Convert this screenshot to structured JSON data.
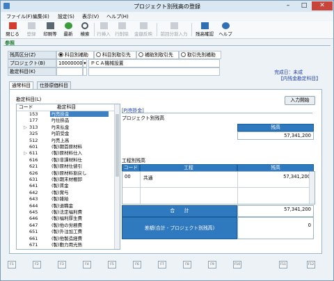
{
  "window": {
    "title": "プロジェクト別残高の登録",
    "min": "–",
    "max": "□",
    "close": "✕"
  },
  "menu": [
    "ファイル(F)",
    "編集(E)",
    "設定(S)",
    "表示(V)",
    "ヘルプ(H)"
  ],
  "toolbar": [
    {
      "label": "閉じる",
      "icon": "close-icon"
    },
    {
      "label": "登録",
      "icon": "save-icon"
    },
    {
      "label": "印刷等",
      "icon": "print-icon"
    },
    {
      "label": "最新",
      "icon": "refresh-icon"
    },
    {
      "label": "検索",
      "icon": "search-icon"
    },
    {
      "label": "行挿入",
      "icon": "insert-row-icon"
    },
    {
      "label": "行削除",
      "icon": "delete-row-icon"
    },
    {
      "label": "金額反映",
      "icon": "amount-apply-icon"
    },
    {
      "label": "前回分割入力",
      "icon": "split-input-icon"
    },
    {
      "label": "残高確認",
      "icon": "balance-check-icon"
    },
    {
      "label": "ヘルプ",
      "icon": "help-icon"
    }
  ],
  "mode": "参照",
  "balance_type": {
    "label": "残高区分(Z)",
    "options": [
      "科目別補助",
      "科目別取引先",
      "補助別取引先",
      "取引先別補助"
    ],
    "selected": "科目別補助"
  },
  "project": {
    "label": "プロジェクト(B)",
    "code": "10000000",
    "name": "ＰＣＡ機械設置"
  },
  "account_field": {
    "label": "勘定科目(K)"
  },
  "status": {
    "line1": "完成日：未成",
    "line2": "【内残金勘定科目】"
  },
  "tabs": [
    "通常科目",
    "仕掛原価科目"
  ],
  "account_list": {
    "label": "勘定科目(L)",
    "headers": [
      "コード",
      "勘定科目"
    ],
    "rows": [
      {
        "code": "153",
        "name": "PJ売掛金",
        "mark": ""
      },
      {
        "code": "177",
        "name": "PJ仕掛品",
        "mark": ""
      },
      {
        "code": "313",
        "name": "PJ未払金",
        "mark": "▷"
      },
      {
        "code": "325",
        "name": "PJ前受金",
        "mark": ""
      },
      {
        "code": "512",
        "name": "PJ売上高",
        "mark": ""
      },
      {
        "code": "601",
        "name": "(製)期首原材料",
        "mark": ""
      },
      {
        "code": "611",
        "name": "(製)原材料仕入",
        "mark": "▷"
      },
      {
        "code": "616",
        "name": "(製)非課材料仕",
        "mark": ""
      },
      {
        "code": "621",
        "name": "(製)原材仕値引",
        "mark": ""
      },
      {
        "code": "626",
        "name": "(製)原材料割戻し",
        "mark": ""
      },
      {
        "code": "631",
        "name": "(製)期末材棚卸",
        "mark": ""
      },
      {
        "code": "641",
        "name": "(製)賃金",
        "mark": ""
      },
      {
        "code": "642",
        "name": "(製)賞与",
        "mark": ""
      },
      {
        "code": "643",
        "name": "(製)雑給",
        "mark": ""
      },
      {
        "code": "644",
        "name": "(製)退職金",
        "mark": ""
      },
      {
        "code": "645",
        "name": "(製)法定福利費",
        "mark": ""
      },
      {
        "code": "646",
        "name": "(製)福利厚生費",
        "mark": ""
      },
      {
        "code": "647",
        "name": "(製)他の労務費",
        "mark": ""
      },
      {
        "code": "651",
        "name": "(製)外注加工費",
        "mark": ""
      },
      {
        "code": "661",
        "name": "(製)他製造経費",
        "mark": ""
      },
      {
        "code": "671",
        "name": "(製)動力用光熱",
        "mark": ""
      }
    ],
    "selected_index": 0
  },
  "detail": {
    "title": "[PJ売掛金]",
    "project_balance": {
      "label": "プロジェクト別残高",
      "col": "残高",
      "value": "57,341,200"
    },
    "process_balance": {
      "label": "工程別残高",
      "headers": [
        "コード",
        "工程",
        "残高"
      ],
      "rows": [
        {
          "code": "00",
          "process": "共通",
          "amount": "57,341,200"
        }
      ]
    },
    "total": {
      "label": "合　　計",
      "value": "57,341,200"
    },
    "diff": {
      "label": "差額(合計 - プロジェクト別残高)",
      "value": "0"
    }
  },
  "input_start_button": "入力開始",
  "fkeys": [
    "F1",
    "F2",
    "F3",
    "F4",
    "F5",
    "F6",
    "F7",
    "F8",
    "F9",
    "F10",
    "F11",
    "F12"
  ]
}
